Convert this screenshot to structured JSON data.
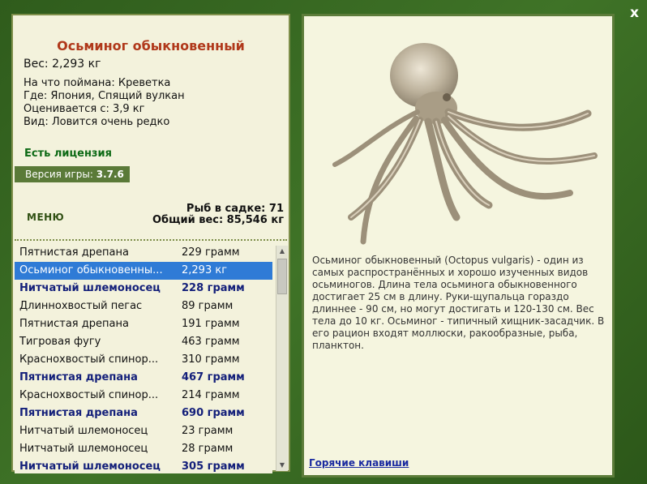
{
  "window": {
    "close_label": "x"
  },
  "fish": {
    "name": "Осьминог обыкновенный",
    "weight": "Вес: 2,293 кг",
    "caught_on": "На что поймана: Креветка",
    "location": "Где: Япония, Спящий вулкан",
    "valued": "Оценивается с: 3,9 кг",
    "rarity": "Вид: Ловится очень редко"
  },
  "license": "Есть лицензия",
  "version": {
    "label": "Версия игры:",
    "value": "3.7.6"
  },
  "menu_label": "МЕНЮ",
  "stats": {
    "fish_count": "Рыб в садке: 71",
    "total_weight": "Общий вес: 85,546 кг"
  },
  "list": [
    {
      "name": "Пятнистая дрепана",
      "weight": "229 грамм"
    },
    {
      "name": "Осьминог обыкновенны...",
      "weight": "2,293 кг"
    },
    {
      "name": "Нитчатый шлемоносец",
      "weight": "228 грамм"
    },
    {
      "name": "Длиннохвостый пегас",
      "weight": "89 грамм"
    },
    {
      "name": "Пятнистая дрепана",
      "weight": "191 грамм"
    },
    {
      "name": "Тигровая фугу",
      "weight": "463 грамм"
    },
    {
      "name": "Краснохвостый спинор...",
      "weight": "310 грамм"
    },
    {
      "name": "Пятнистая дрепана",
      "weight": "467 грамм"
    },
    {
      "name": "Краснохвостый спинор...",
      "weight": "214 грамм"
    },
    {
      "name": "Пятнистая дрепана",
      "weight": "690 грамм"
    },
    {
      "name": "Нитчатый шлемоносец",
      "weight": "23 грамм"
    },
    {
      "name": "Нитчатый шлемоносец",
      "weight": "28 грамм"
    },
    {
      "name": "Нитчатый шлемоносец",
      "weight": "305 грамм"
    }
  ],
  "description": "Осьминог обыкновенный (Octopus vulgaris) - один из самых распространённых и хорошо изученных видов осьминогов. Длина тела осьминога обыкновенного достигает 25 см в длину. Руки-щупальца гораздо длиннее - 90 см, но могут достигать и 120-130 см. Вес тела до 10 кг. Осьминог - типичный хищник-засадчик. В его рацион входят моллюски, ракообразные, рыба, планктон.",
  "hotkeys_label": "Горячие клавиши",
  "icons": {
    "close": "close-icon",
    "scroll_up": "arrow-up-icon",
    "scroll_down": "arrow-down-icon",
    "photo": "octopus-photo"
  }
}
